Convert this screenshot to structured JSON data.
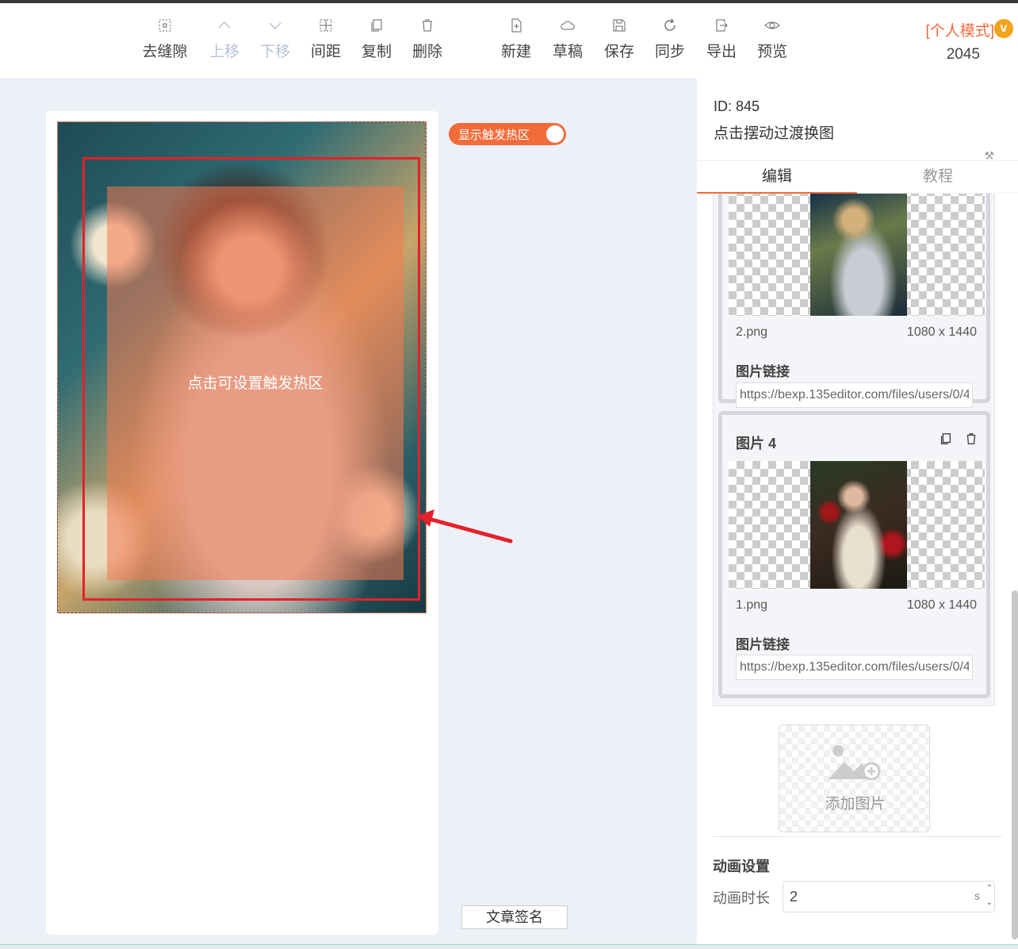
{
  "toolbar": {
    "items": [
      {
        "label": "去缝隙",
        "icon": "gap-icon"
      },
      {
        "label": "上移",
        "icon": "chevron-up-icon"
      },
      {
        "label": "下移",
        "icon": "chevron-down-icon"
      },
      {
        "label": "间距",
        "icon": "spacing-icon"
      },
      {
        "label": "复制",
        "icon": "copy-icon"
      },
      {
        "label": "删除",
        "icon": "trash-icon"
      },
      {
        "label": "新建",
        "icon": "new-file-icon"
      },
      {
        "label": "草稿",
        "icon": "cloud-icon"
      },
      {
        "label": "保存",
        "icon": "save-icon"
      },
      {
        "label": "同步",
        "icon": "sync-icon"
      },
      {
        "label": "导出",
        "icon": "export-icon"
      },
      {
        "label": "预览",
        "icon": "eye-icon"
      }
    ],
    "mode": "[个人模式]",
    "badge": "v",
    "count": "2045"
  },
  "canvas": {
    "toggle_label": "显示触发热区",
    "hotspot_text": "点击可设置触发热区",
    "signature_label": "文章签名"
  },
  "panel": {
    "id": "ID: 845",
    "name": "点击摆动过渡换图",
    "tabs": [
      "编辑",
      "教程"
    ],
    "items": [
      {
        "title": "",
        "file": "2.png",
        "size": "1080 x 1440",
        "link_label": "图片链接",
        "link": "https://bexp.135editor.com/files/users/0/4"
      },
      {
        "title": "图片 4",
        "file": "1.png",
        "size": "1080 x 1440",
        "link_label": "图片链接",
        "link": "https://bexp.135editor.com/files/users/0/4"
      }
    ],
    "add_image": "添加图片",
    "animation": {
      "title": "动画设置",
      "duration_label": "动画时长",
      "duration_value": "2",
      "unit": "s"
    }
  },
  "colors": {
    "accent": "#f26b3a",
    "hotspot_border": "#e3212b",
    "badge": "#f3a21a"
  }
}
